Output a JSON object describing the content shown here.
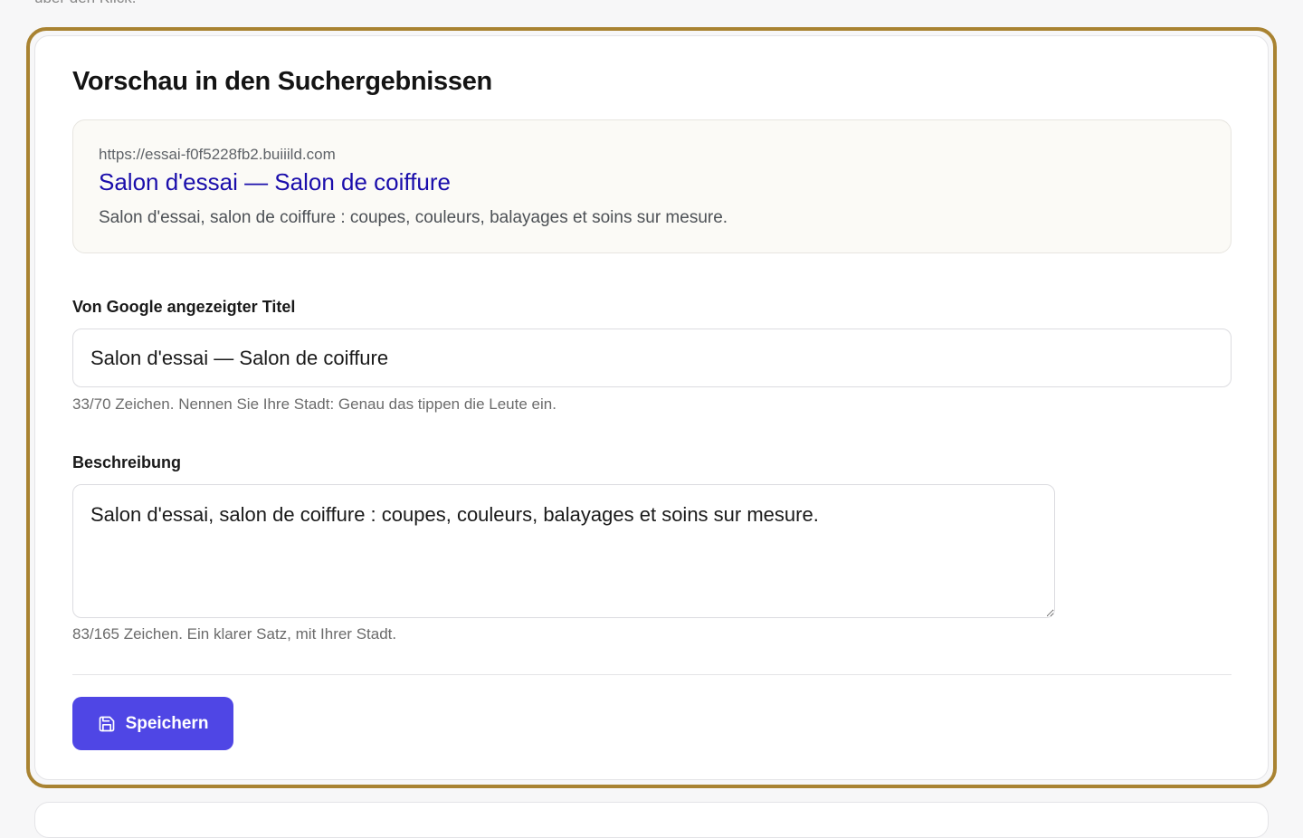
{
  "top_clip": "über den Klick.",
  "seo_card": {
    "title": "Vorschau in den Suchergebnissen",
    "preview": {
      "url": "https://essai-f0f5228fb2.buiiild.com",
      "title": "Salon d'essai — Salon de coiffure",
      "description": "Salon d'essai, salon de coiffure : coupes, couleurs, balayages et soins sur mesure."
    },
    "title_field": {
      "label": "Von Google angezeigter Titel",
      "value": "Salon d'essai — Salon de coiffure",
      "hint": "33/70 Zeichen. Nennen Sie Ihre Stadt: Genau das tippen die Leute ein."
    },
    "description_field": {
      "label": "Beschreibung",
      "value": "Salon d'essai, salon de coiffure : coupes, couleurs, balayages et soins sur mesure.",
      "hint": "83/165 Zeichen. Ein klarer Satz, mit Ihrer Stadt."
    },
    "save_button": {
      "label": "Speichern",
      "icon": "save-icon"
    }
  },
  "colors": {
    "highlight": "#a98332",
    "primary": "#4f46e5",
    "link": "#1a0dab"
  }
}
